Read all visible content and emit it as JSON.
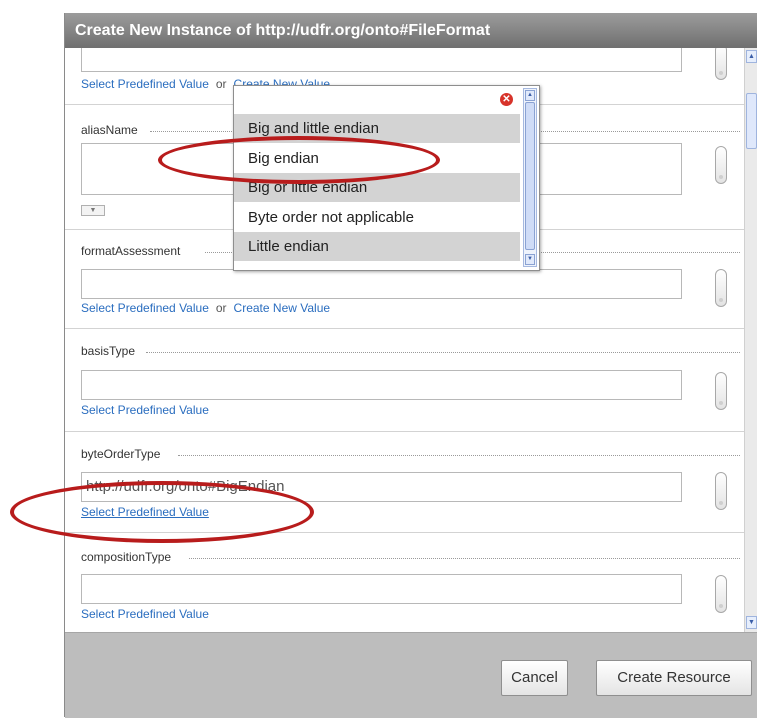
{
  "dialog": {
    "title": "Create New Instance of http://udfr.org/onto#FileFormat"
  },
  "links": {
    "select_predefined": "Select Predefined Value",
    "or": "or",
    "create_new": "Create New Value"
  },
  "fields": {
    "aliasName": {
      "label": "aliasName"
    },
    "formatAssessment": {
      "label": "formatAssessment"
    },
    "basisType": {
      "label": "basisType"
    },
    "byteOrderType": {
      "label": "byteOrderType",
      "value": "http://udfr.org/onto#BigEndian"
    },
    "compositionType": {
      "label": "compositionType"
    }
  },
  "popup": {
    "options": [
      "Big and little endian",
      "Big endian",
      "Big or little endian",
      "Byte order not applicable",
      "Little endian"
    ]
  },
  "buttons": {
    "cancel": "Cancel",
    "create_resource": "Create Resource"
  },
  "colors": {
    "annotation_red": "#b81c1c",
    "link_blue": "#2a6dbf",
    "close_red": "#d7332a"
  }
}
